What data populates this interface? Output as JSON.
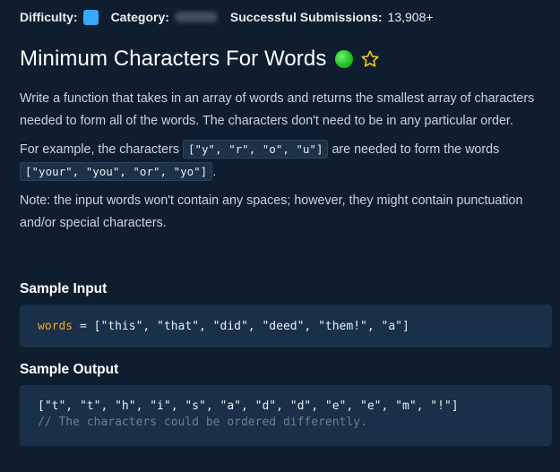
{
  "meta": {
    "difficulty_label": "Difficulty:",
    "category_label": "Category:",
    "submissions_label": "Successful Submissions:",
    "submissions_count": "13,908+",
    "difficulty_color": "#35a9ff"
  },
  "problem": {
    "title": "Minimum Characters For Words",
    "status_icon": "completed-circle-icon",
    "favorite_icon": "star-outline-icon"
  },
  "description": {
    "p1": "Write a function that takes in an array of words and returns the smallest array of characters needed to form all of the words. The characters don't need to be in any particular order.",
    "p2_before": "For example, the characters ",
    "p2_code1": "[\"y\", \"r\", \"o\", \"u\"]",
    "p2_mid": " are needed to form the words ",
    "p2_code2": "[\"your\", \"you\", \"or\", \"yo\"]",
    "p2_after": ".",
    "p3": "Note: the input words won't contain any spaces; however, they might contain punctuation and/or special characters."
  },
  "sample_input": {
    "title": "Sample Input",
    "var_name": "words",
    "rest": " = [\"this\", \"that\", \"did\", \"deed\", \"them!\", \"a\"]"
  },
  "sample_output": {
    "title": "Sample Output",
    "line1": "[\"t\", \"t\", \"h\", \"i\", \"s\", \"a\", \"d\", \"d\", \"e\", \"e\", \"m\", \"!\"]",
    "comment": "// The characters could be ordered differently."
  }
}
